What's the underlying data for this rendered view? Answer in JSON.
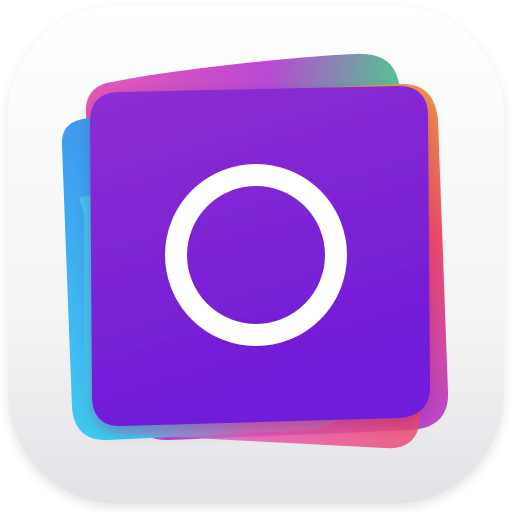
{
  "app_icon": {
    "name": "",
    "colors": {
      "tile_light": "#ffffff",
      "tile_mid": "#f3f3f5",
      "tile_shadow": "#e3e3e7",
      "front_purple_top": "#8d2ed1",
      "front_purple_bottom": "#6f1bd8",
      "layer_blue": "#2f8ff0",
      "layer_cyan": "#32c8ef",
      "layer_green": "#37d47d",
      "layer_pink": "#e84cad",
      "layer_red": "#ef3c5f",
      "layer_orange": "#f38d3a",
      "layer_magenta": "#b43ad2",
      "ring": "#ffffff"
    },
    "glyph": "ring-icon"
  }
}
